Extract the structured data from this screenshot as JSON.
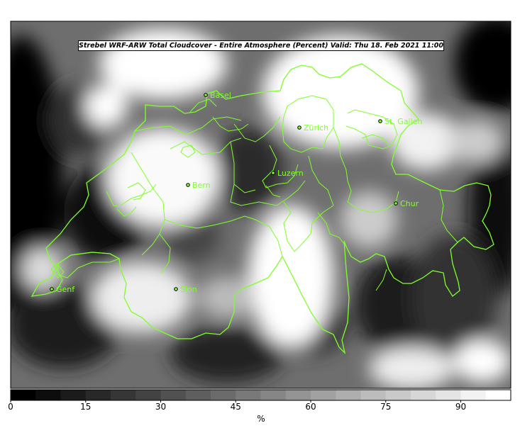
{
  "map": {
    "title": "Strebel WRF-ARW Total Cloudcover - Entire Atmosphere (Percent)   Valid: Thu 18. Feb 2021 11:00",
    "border_color": "#7fff2a",
    "cities": [
      {
        "name": "Basel"
      },
      {
        "name": "Zürich"
      },
      {
        "name": "St. Gallen"
      },
      {
        "name": "Luzern"
      },
      {
        "name": "Bern"
      },
      {
        "name": "Chur"
      },
      {
        "name": "Sion"
      },
      {
        "name": "Genf"
      }
    ]
  },
  "colorbar": {
    "unit": "%",
    "ticks": [
      "0",
      "15",
      "30",
      "45",
      "60",
      "75",
      "90"
    ],
    "min": 0,
    "max": 100,
    "levels": 20,
    "color_low": "#000000",
    "color_high": "#ffffff"
  }
}
